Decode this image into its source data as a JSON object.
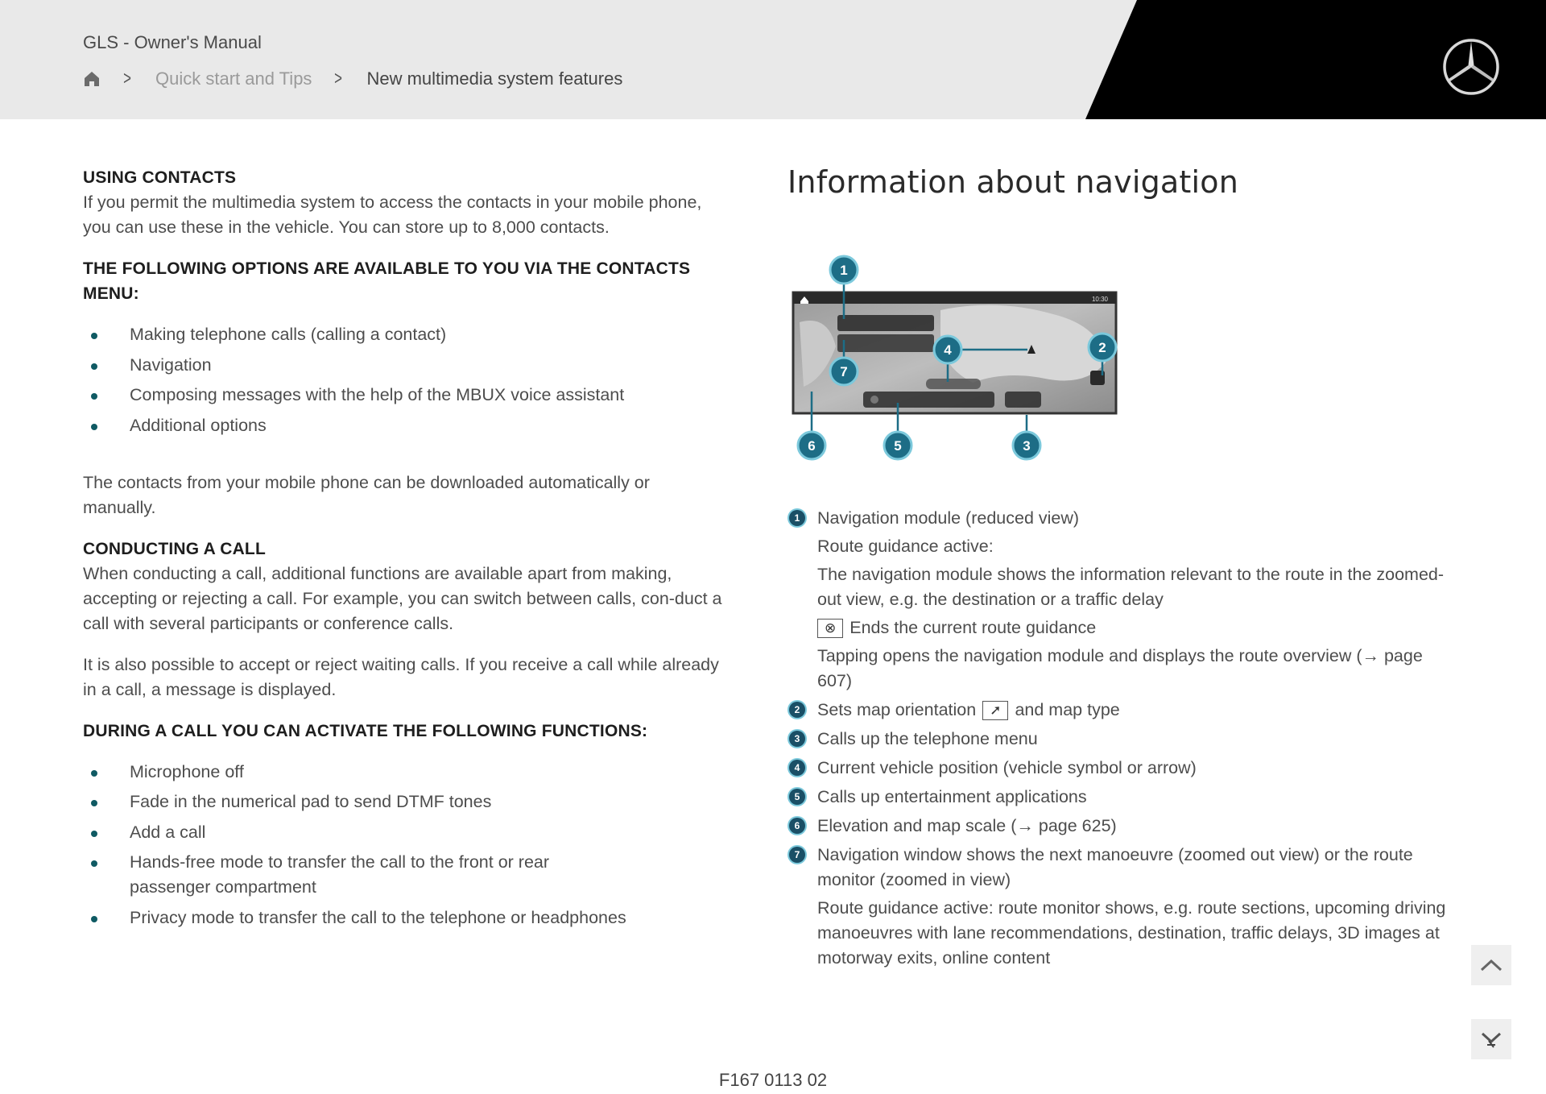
{
  "header": {
    "doc_title": "GLS - Owner's Manual",
    "breadcrumb": {
      "home_icon": "home-icon",
      "separator_icon": "chevron-right-icon",
      "items": [
        "Quick start and Tips",
        "New multimedia system features"
      ]
    },
    "logo": "mercedes-star-logo",
    "colors": {
      "header_bg": "#e9e9e9",
      "logo_panel": "#000000"
    }
  },
  "left": {
    "using_contacts": {
      "heading": "USING CONTACTS",
      "body": "If you permit the multimedia system to access the contacts in your mobile phone, you can use these in the vehicle. You can store up to 8,000 contacts."
    },
    "options_heading_line1": "THE FOLLOWING OPTIONS ARE AVAILABLE TO YOU VIA THE CONTACTS",
    "options_heading_line2": "MENU:",
    "options": [
      "Making telephone calls (calling a contact)",
      "Navigation",
      "Composing messages with the help of the MBUX voice assistant",
      "Additional options"
    ],
    "download_note": "The contacts from your mobile phone can be downloaded automatically or manually.",
    "conducting": {
      "heading": "CONDUCTING A CALL",
      "body": "When conducting a call, additional functions are available apart from making, accepting or rejecting a call. For example, you can switch between calls, con-duct a call with several participants or conference calls.",
      "waiting": "It is also possible to accept or reject waiting calls. If you receive a call while already in a call, a message is displayed."
    },
    "during_heading": "DURING A CALL YOU CAN ACTIVATE THE FOLLOWING FUNCTIONS:",
    "during_items": [
      "Microphone off",
      "Fade in the numerical pad to send DTMF tones",
      "Add a call",
      "Hands-free mode to transfer the call to the front or rear passenger compartment",
      "Privacy mode to transfer the call to the telephone or headphones"
    ],
    "bullet_color": "#0f5a63"
  },
  "right": {
    "title": "Information about navigation",
    "diagram": {
      "callouts": [
        "1",
        "2",
        "3",
        "4",
        "5",
        "6",
        "7"
      ],
      "status_time": "10:30",
      "callout_color": "#1d6d86",
      "callout_ring_color": "#7cc9dc"
    },
    "legend": [
      {
        "num": "1",
        "text": "Navigation module (reduced view)",
        "sub": [
          "Route guidance active:",
          "The navigation module shows the information relevant to the route in the zoomed-out view, e.g. the destination or a traffic delay"
        ],
        "cancel_icon": "cancel-route-icon",
        "cancel_text": "Ends the current route guidance",
        "tap_text": "Tapping opens the navigation module and displays the route overview (→ page 607)"
      },
      {
        "num": "2",
        "text_before": "Sets map orientation",
        "icon": "compass-icon",
        "text_after": "and map type"
      },
      {
        "num": "3",
        "text": "Calls up the telephone menu"
      },
      {
        "num": "4",
        "text": "Current vehicle position (vehicle symbol or arrow)"
      },
      {
        "num": "5",
        "text": "Calls up entertainment applications"
      },
      {
        "num": "6",
        "text": "Elevation and map scale (→ page 625)"
      },
      {
        "num": "7",
        "text": "Navigation window shows the next manoeuvre (zoomed out view) or the route monitor (zoomed in view)",
        "sub": "Route guidance active: route monitor shows, e.g. route sections, upcoming driving manoeuvres with lane recommendations, destination, traffic delays, 3D images at motorway exits, online content"
      }
    ]
  },
  "controls": {
    "scroll_up_icon": "chevron-up-icon",
    "scroll_down_icon": "chevron-down-icon"
  },
  "footer": {
    "code": "F167 0113 02"
  }
}
